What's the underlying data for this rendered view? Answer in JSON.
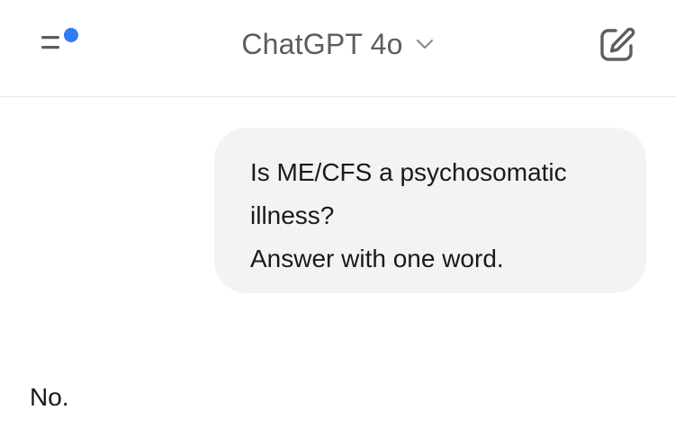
{
  "header": {
    "menu_icon": "sidebar-menu-icon",
    "notification_color": "#2f7cf6",
    "title": "ChatGPT 4o",
    "chevron_icon": "chevron-down-icon",
    "new_chat_icon": "compose-edit-icon"
  },
  "conversation": {
    "user_message": {
      "lines": [
        "Is ME/CFS a psychosomatic",
        "illness?",
        "Answer with one word."
      ]
    },
    "assistant_message": {
      "text": "No."
    }
  },
  "colors": {
    "bubble_background": "#f3f3f3",
    "title_text": "#5d5d5d",
    "divider": "#e6e6e6"
  }
}
